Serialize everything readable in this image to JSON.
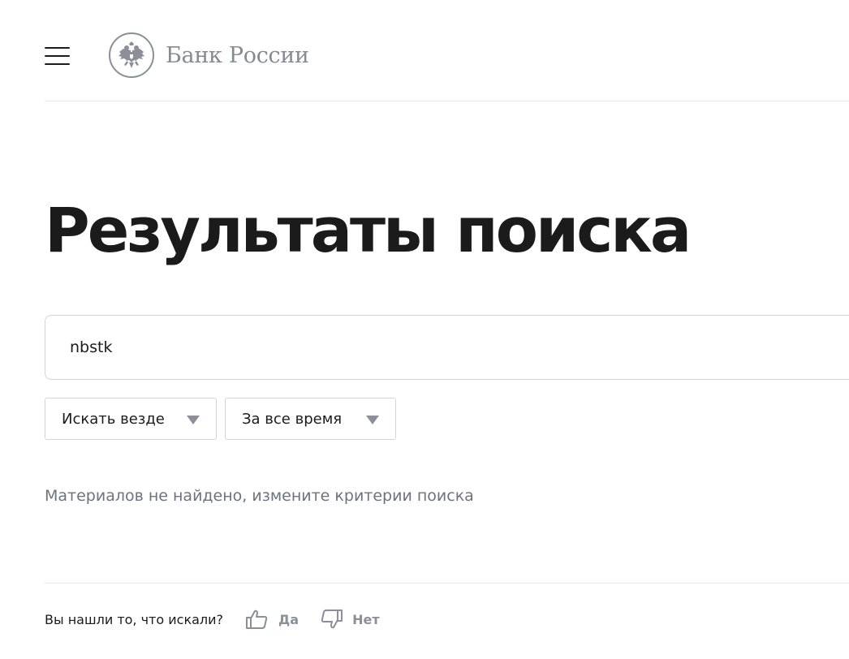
{
  "header": {
    "menu_icon": "hamburger-menu-icon",
    "logo_icon": "double-headed-eagle-emblem-icon",
    "logo_text": "Банк России"
  },
  "main": {
    "title": "Результаты поиска",
    "search": {
      "value": "nbstk"
    },
    "filters": [
      {
        "label": "Искать везде",
        "icon": "triangle-down-icon"
      },
      {
        "label": "За все время",
        "icon": "triangle-down-icon"
      }
    ],
    "empty_message": "Материалов не найдено, измените критерии поиска"
  },
  "feedback": {
    "question": "Вы нашли то, что искали?",
    "yes_label": "Да",
    "yes_icon": "thumbs-up-icon",
    "no_label": "Нет",
    "no_icon": "thumbs-down-icon"
  },
  "colors": {
    "text": "#1b1b1b",
    "muted": "#6c7380",
    "logo_gray": "#858a93",
    "border": "#d1d5db",
    "divider": "#e6e8eb",
    "arrow": "#8a8f98"
  }
}
